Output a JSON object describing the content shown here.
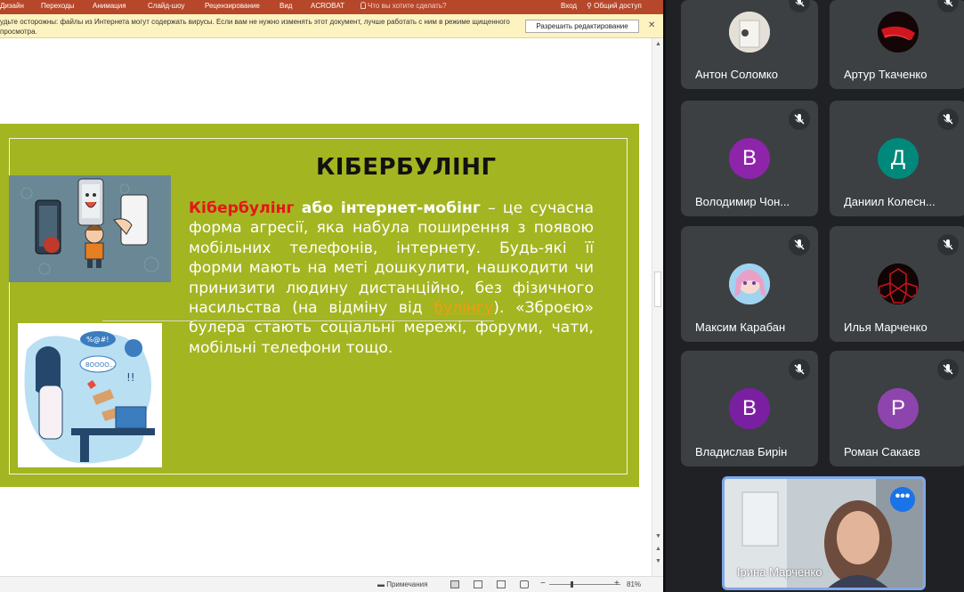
{
  "ribbon": {
    "tabs": [
      "Дизайн",
      "Переходы",
      "Анимация",
      "Слайд-шоу",
      "Рецензирование",
      "Вид",
      "ACROBAT"
    ],
    "tell_me": "Что вы хотите сделать?",
    "signin": "Вход",
    "share": "Общий доступ",
    "color": "#b7472a"
  },
  "warning_bar": {
    "message": "удьте осторожны: файлы из Интернета могут содержать вирусы. Если вам не нужно изменять этот документ, лучше работать с ним в режиме щищенного просмотра.",
    "enable_button": "Разрешить редактирование",
    "close": "✕"
  },
  "slide": {
    "title": "КІБЕРБУЛІНГ",
    "term": "Кібербулінг",
    "term_conj": "або інтернет-мобінг",
    "text_1": " – це сучасна форма агресії, яка набула поширення з появою мобільних телефонів, інтернету. Будь-які її форми мають на меті дошкулити, нашкодити чи принизити людину дистанційно, без фізичного насильства (на відміну від ",
    "link": "булінгу",
    "text_2": "). «Зброєю» булера стають соціальні мережі, форуми, чати, мобільні телефони тощо.",
    "background": "#a3b520",
    "term_color": "#e6141a"
  },
  "statusbar": {
    "notes": "Примечания",
    "zoom_minus": "−",
    "zoom_plus": "+",
    "zoom": "81%"
  },
  "participants": [
    {
      "name": "Антон Соломко",
      "avatar_type": "photo",
      "avatar_color": "#d8d2c8"
    },
    {
      "name": "Артур Ткаченко",
      "avatar_type": "photo",
      "avatar_color": "#1a0a0a"
    },
    {
      "name": "Володимир Чон...",
      "avatar_type": "letter",
      "letter": "В",
      "avatar_color": "#8e24aa"
    },
    {
      "name": "Даниил Колесн...",
      "avatar_type": "letter",
      "letter": "Д",
      "avatar_color": "#00897b"
    },
    {
      "name": "Максим Карабан",
      "avatar_type": "photo",
      "avatar_color": "#c9a6d8"
    },
    {
      "name": "Илья Марченко",
      "avatar_type": "photo",
      "avatar_color": "#1b0b0b"
    },
    {
      "name": "Владислав Бирін",
      "avatar_type": "letter",
      "letter": "В",
      "avatar_color": "#7b1fa2"
    },
    {
      "name": "Роман Сакаєв",
      "avatar_type": "letter",
      "letter": "Р",
      "avatar_color": "#8e44ad"
    }
  ],
  "self_view": {
    "name": "Ірина Марченко",
    "more_icon": "more-dots-icon",
    "border_color": "#7fa7e8"
  }
}
